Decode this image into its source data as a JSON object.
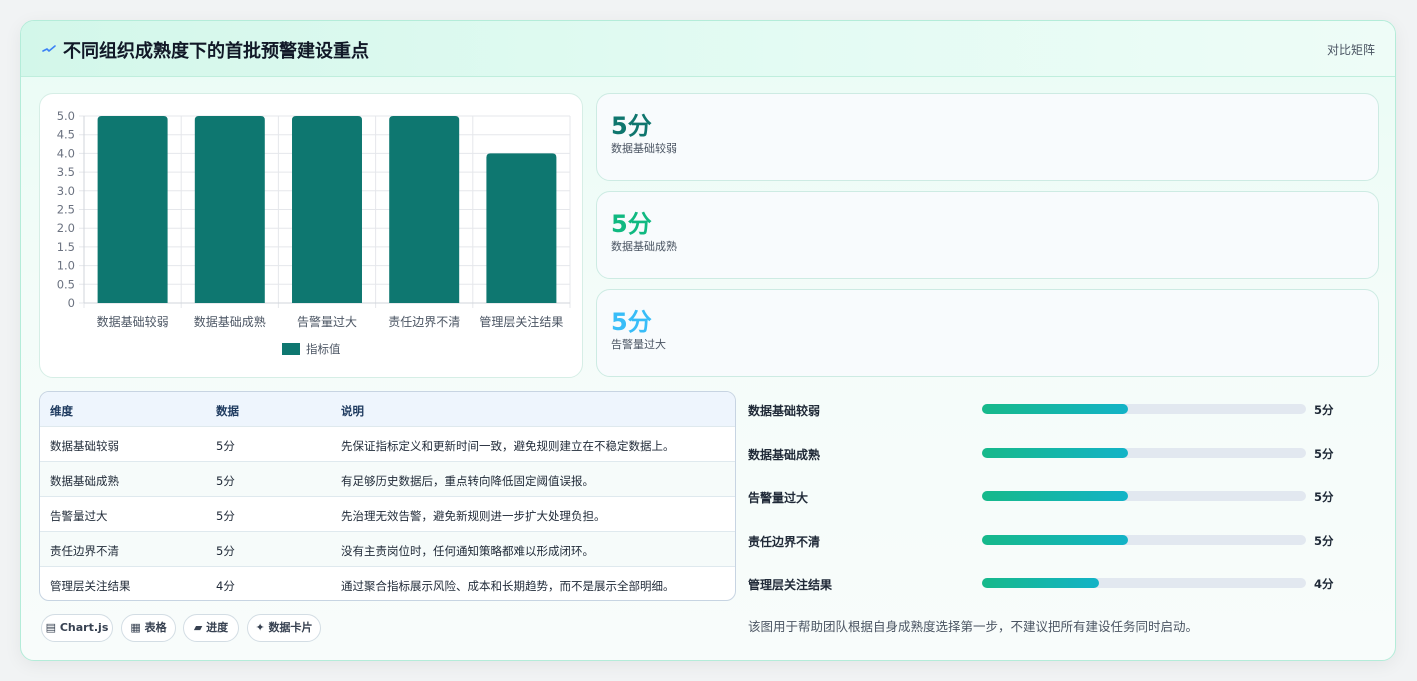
{
  "header": {
    "title": "不同组织成熟度下的首批预警建设重点",
    "link": "对比矩阵"
  },
  "chart_data": {
    "type": "bar",
    "categories": [
      "数据基础较弱",
      "数据基础成熟",
      "告警量过大",
      "责任边界不清",
      "管理层关注结果"
    ],
    "series": [
      {
        "name": "指标值",
        "values": [
          5,
          5,
          5,
          5,
          4
        ]
      }
    ],
    "yticks": [
      "0",
      "0.5",
      "1.0",
      "1.5",
      "2.0",
      "2.5",
      "3.0",
      "3.5",
      "4.0",
      "4.5",
      "5.0"
    ],
    "ylim": [
      0,
      5
    ],
    "color": "#0e7770",
    "legend": "bottom",
    "grid": true
  },
  "stats": [
    {
      "value": "5分",
      "label": "数据基础较弱",
      "color": "#0f766e"
    },
    {
      "value": "5分",
      "label": "数据基础成熟",
      "color": "#10b981"
    },
    {
      "value": "5分",
      "label": "告警量过大",
      "color": "#38bdf8"
    }
  ],
  "table": {
    "headers": [
      "维度",
      "数据",
      "说明"
    ],
    "rows": [
      [
        "数据基础较弱",
        "5分",
        "先保证指标定义和更新时间一致，避免规则建立在不稳定数据上。"
      ],
      [
        "数据基础成熟",
        "5分",
        "有足够历史数据后，重点转向降低固定阈值误报。"
      ],
      [
        "告警量过大",
        "5分",
        "先治理无效告警，避免新规则进一步扩大处理负担。"
      ],
      [
        "责任边界不清",
        "5分",
        "没有主责岗位时，任何通知策略都难以形成闭环。"
      ],
      [
        "管理层关注结果",
        "4分",
        "通过聚合指标展示风险、成本和长期趋势，而不是展示全部明细。"
      ]
    ]
  },
  "tags": [
    {
      "icon": "▤",
      "label": "Chart.js"
    },
    {
      "icon": "▦",
      "label": "表格"
    },
    {
      "icon": "▰",
      "label": "进度"
    },
    {
      "icon": "✦",
      "label": "数据卡片"
    }
  ],
  "progress": [
    {
      "label": "数据基础较弱",
      "value": "5分",
      "fraction": 0.45
    },
    {
      "label": "数据基础成熟",
      "value": "5分",
      "fraction": 0.45
    },
    {
      "label": "告警量过大",
      "value": "5分",
      "fraction": 0.45
    },
    {
      "label": "责任边界不清",
      "value": "5分",
      "fraction": 0.45
    },
    {
      "label": "管理层关注结果",
      "value": "4分",
      "fraction": 0.36
    }
  ],
  "note": "该图用于帮助团队根据自身成熟度选择第一步，不建议把所有建设任务同时启动。"
}
